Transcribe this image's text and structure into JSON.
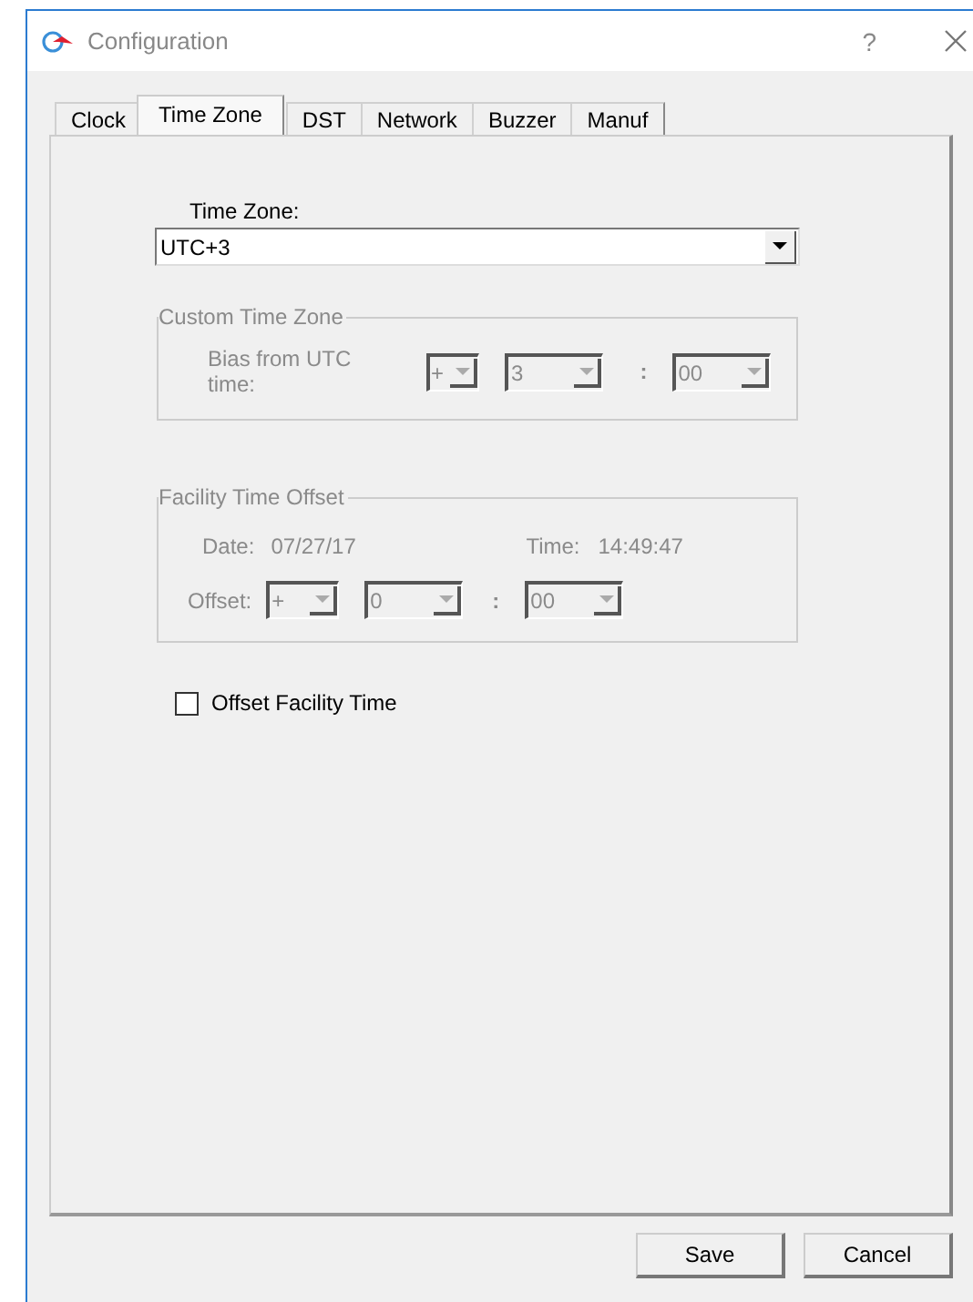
{
  "window": {
    "title": "Configuration",
    "help": "?"
  },
  "tabs": [
    {
      "label": "Clock",
      "selected": false
    },
    {
      "label": "Time Zone",
      "selected": true
    },
    {
      "label": "DST",
      "selected": false
    },
    {
      "label": "Network",
      "selected": false
    },
    {
      "label": "Buzzer",
      "selected": false
    },
    {
      "label": "Manuf",
      "selected": false
    }
  ],
  "time_zone": {
    "label": "Time Zone:",
    "value": "UTC+3"
  },
  "custom_time_zone": {
    "title": "Custom Time Zone",
    "disabled": true,
    "bias_label": "Bias from UTC time:",
    "sign": "+",
    "hours": "3",
    "separator": ":",
    "minutes": "00"
  },
  "facility_time_offset": {
    "title": "Facility Time Offset",
    "disabled": true,
    "date_label": "Date:",
    "date": "07/27/17",
    "time_label": "Time:",
    "time": "14:49:47",
    "offset_label": "Offset:",
    "sign": "+",
    "hours": "0",
    "separator": ":",
    "minutes": "00"
  },
  "offset_facility_time": {
    "label": "Offset Facility Time",
    "checked": false
  },
  "buttons": [
    "Save",
    "Cancel"
  ]
}
